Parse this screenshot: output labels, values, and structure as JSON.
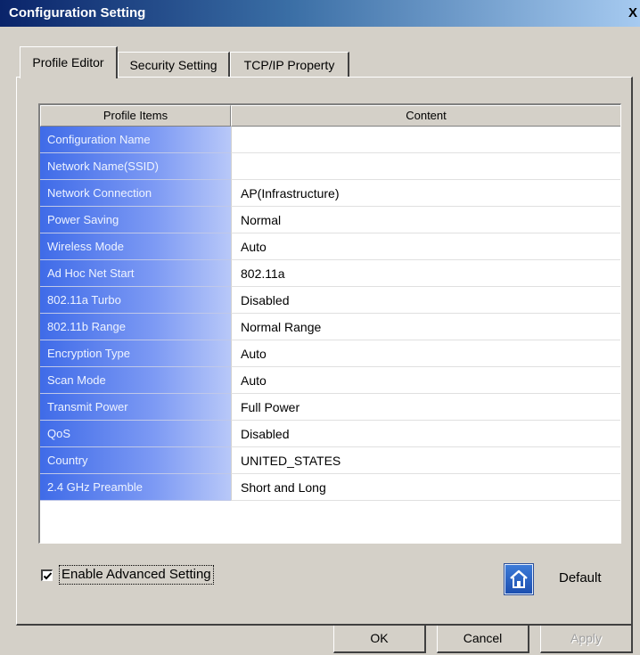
{
  "window": {
    "title": "Configuration Setting",
    "close_label": "X"
  },
  "tabs": [
    {
      "label": "Profile Editor",
      "active": true
    },
    {
      "label": "Security Setting",
      "active": false
    },
    {
      "label": "TCP/IP Property",
      "active": false
    }
  ],
  "table": {
    "headers": [
      "Profile Items",
      "Content"
    ],
    "rows": [
      {
        "item": "Configuration Name",
        "content": ""
      },
      {
        "item": "Network Name(SSID)",
        "content": ""
      },
      {
        "item": "Network Connection",
        "content": "AP(Infrastructure)"
      },
      {
        "item": "Power Saving",
        "content": "Normal"
      },
      {
        "item": "Wireless Mode",
        "content": "Auto"
      },
      {
        "item": "Ad Hoc Net Start",
        "content": "802.11a"
      },
      {
        "item": "802.11a Turbo",
        "content": "Disabled"
      },
      {
        "item": "802.11b Range",
        "content": "Normal Range"
      },
      {
        "item": "Encryption Type",
        "content": "Auto"
      },
      {
        "item": "Scan Mode",
        "content": "Auto"
      },
      {
        "item": "Transmit Power",
        "content": "Full Power"
      },
      {
        "item": "QoS",
        "content": "Disabled"
      },
      {
        "item": "Country",
        "content": "UNITED_STATES"
      },
      {
        "item": "2.4 GHz Preamble",
        "content": "Short and Long"
      }
    ]
  },
  "advanced": {
    "label": "Enable Advanced Setting",
    "checked": true
  },
  "default_button": {
    "label": "Default",
    "icon": "home-icon"
  },
  "buttons": {
    "ok": "OK",
    "cancel": "Cancel",
    "apply": "Apply"
  },
  "colors": {
    "title_bar": "#0a246a",
    "item_cell": "#3f6be8",
    "window_bg": "#d4d0c8"
  }
}
